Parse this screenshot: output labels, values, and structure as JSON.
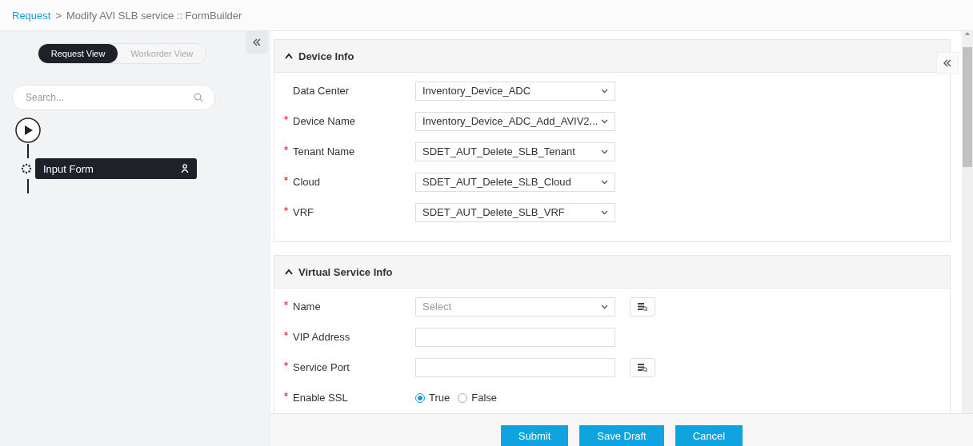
{
  "breadcrumb": {
    "link": "Request",
    "separator": ">",
    "current": "Modify AVI SLB service :: FormBuilder"
  },
  "view_toggle": [
    {
      "label": "Request View",
      "selected": true
    },
    {
      "label": "Workorder View",
      "selected": false
    }
  ],
  "search": {
    "placeholder": "Search..."
  },
  "flow": {
    "steps": [
      {
        "label": "Input Form"
      }
    ]
  },
  "sections": [
    {
      "title": "Device Info",
      "expanded": true,
      "fields": [
        {
          "kind": "select",
          "label": "Data Center",
          "required": false,
          "value": "Inventory_Device_ADC",
          "lookup": false
        },
        {
          "kind": "select",
          "label": "Device Name",
          "required": true,
          "value": "Inventory_Device_ADC_Add_AVIV2...",
          "lookup": false
        },
        {
          "kind": "select",
          "label": "Tenant Name",
          "required": true,
          "value": "SDET_AUT_Delete_SLB_Tenant",
          "lookup": false
        },
        {
          "kind": "select",
          "label": "Cloud",
          "required": true,
          "value": "SDET_AUT_Delete_SLB_Cloud",
          "lookup": false
        },
        {
          "kind": "select",
          "label": "VRF",
          "required": true,
          "value": "SDET_AUT_Delete_SLB_VRF",
          "lookup": false
        }
      ]
    },
    {
      "title": "Virtual Service Info",
      "expanded": true,
      "fields": [
        {
          "kind": "select",
          "label": "Name",
          "required": true,
          "placeholder": "Select",
          "lookup": true
        },
        {
          "kind": "text",
          "label": "VIP Address",
          "required": true,
          "lookup": false
        },
        {
          "kind": "text",
          "label": "Service Port",
          "required": true,
          "lookup": true
        },
        {
          "kind": "radio",
          "label": "Enable SSL",
          "required": true,
          "lookup": false,
          "options": [
            {
              "label": "True",
              "selected": true
            },
            {
              "label": "False",
              "selected": false
            }
          ]
        }
      ]
    }
  ],
  "buttons": [
    "Submit",
    "Save Draft",
    "Cancel"
  ]
}
